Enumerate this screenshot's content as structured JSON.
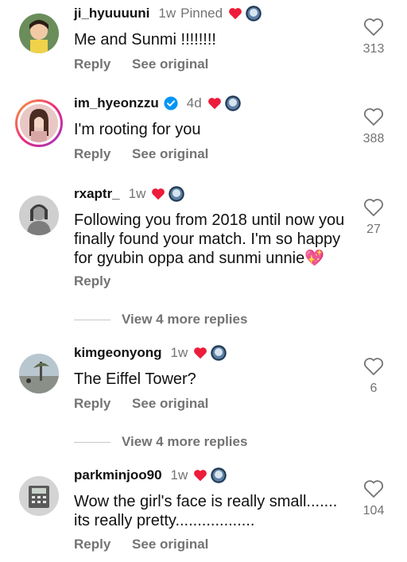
{
  "comments": [
    {
      "username": "ji_hyuuuuni",
      "time": "1w",
      "pinned": "Pinned",
      "text": "Me and Sunmi !!!!!!!!",
      "reply": "Reply",
      "see_original": "See original",
      "likes": "313"
    },
    {
      "username": "im_hyeonzzu",
      "time": "4d",
      "text": "I'm rooting for you",
      "reply": "Reply",
      "see_original": "See original",
      "likes": "388"
    },
    {
      "username": "rxaptr_",
      "time": "1w",
      "text": "Following you from 2018 until now you finally found your match. I'm so happy for gyubin oppa and sunmi unnie💖",
      "reply": "Reply",
      "likes": "27",
      "more_replies": "View 4 more replies"
    },
    {
      "username": "kimgeonyong",
      "time": "1w",
      "text": "The Eiffel Tower?",
      "reply": "Reply",
      "see_original": "See original",
      "likes": "6",
      "more_replies": "View 4 more replies"
    },
    {
      "username": "parkminjoo90",
      "time": "1w",
      "text": "Wow the girl's face is really small....... its really pretty..................",
      "reply": "Reply",
      "see_original": "See original",
      "likes": "104"
    }
  ],
  "colors": {
    "heart": "#ed1c3a",
    "secondary_text": "#737373",
    "verified": "#0095f6"
  }
}
